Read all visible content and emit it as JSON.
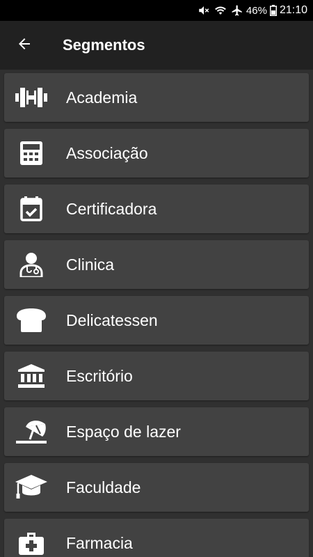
{
  "status_bar": {
    "battery_text": "46%",
    "time": "21:10",
    "icons": [
      "mute-icon",
      "wifi-icon",
      "airplane-icon",
      "battery-icon"
    ]
  },
  "app_bar": {
    "title": "Segmentos",
    "back_icon": "arrow-left-icon"
  },
  "segments": [
    {
      "label": "Academia",
      "icon": "dumbbell-icon"
    },
    {
      "label": "Associação",
      "icon": "calculator-icon"
    },
    {
      "label": "Certificadora",
      "icon": "calendar-check-icon"
    },
    {
      "label": "Clinica",
      "icon": "doctor-icon"
    },
    {
      "label": "Delicatessen",
      "icon": "bread-icon"
    },
    {
      "label": "Escritório",
      "icon": "bank-icon"
    },
    {
      "label": "Espaço de lazer",
      "icon": "beach-umbrella-icon"
    },
    {
      "label": "Faculdade",
      "icon": "graduation-cap-icon"
    },
    {
      "label": "Farmacia",
      "icon": "medical-bag-icon"
    }
  ],
  "colors": {
    "background": "#303030",
    "app_bar": "#212121",
    "card": "#424242",
    "text": "#ffffff"
  }
}
